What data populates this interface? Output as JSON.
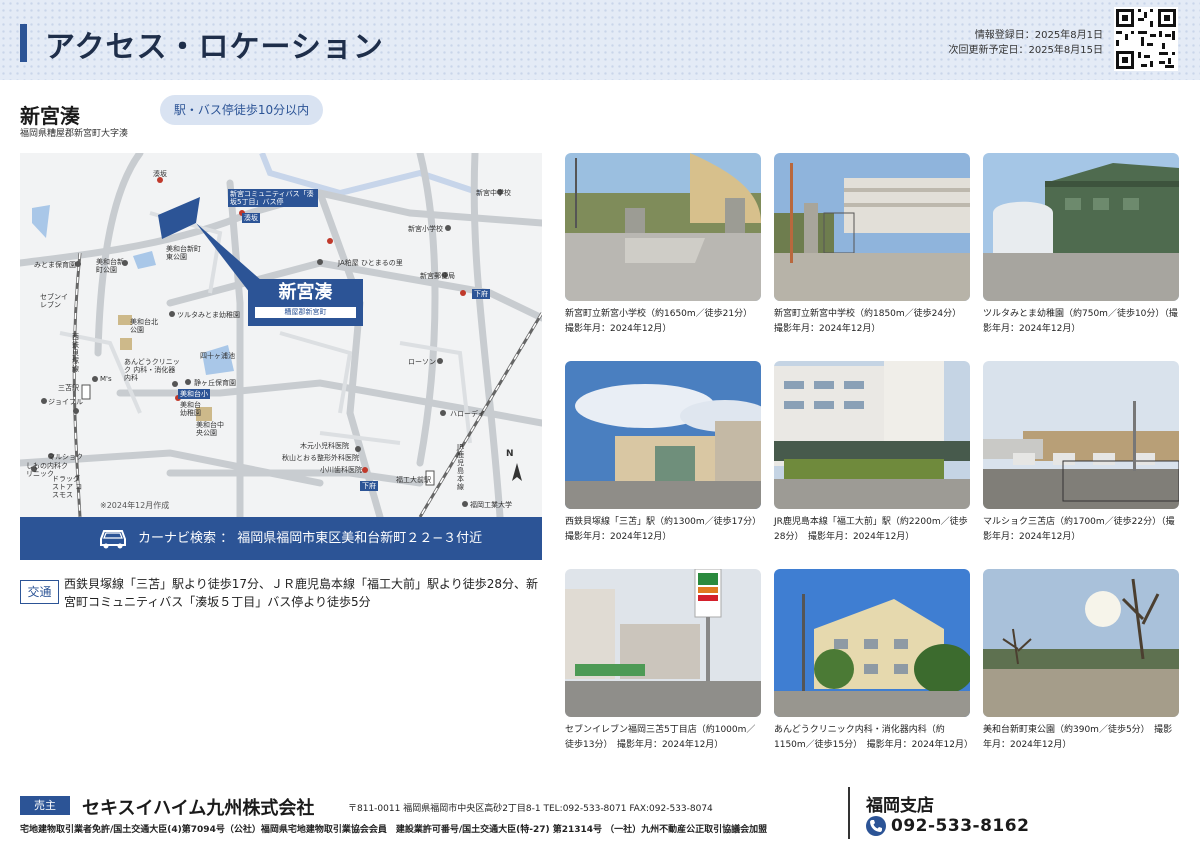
{
  "header": {
    "title": "アクセス・ロケーション",
    "registered": "情報登録日：2025年8月1日",
    "next_update": "次回更新予定日：2025年8月15日"
  },
  "property": {
    "name": "新宮湊",
    "address": "福岡県糟屋郡新宮町大字湊",
    "walk_badge": "駅・バス停徒歩10分以内"
  },
  "map": {
    "callout_name": "新宮湊",
    "callout_sub": "糟屋郡新宮町",
    "made": "※2024年12月作成",
    "north": "N",
    "labels": {
      "l_minato": "湊坂",
      "l_bus": "新宮コミュニティバス「湊坂5丁目」バス停",
      "l_bus2": "湊坂",
      "l_mitomahoiku": "みとま保育園",
      "l_miwadai_park": "美和台新町公園",
      "l_miwadai_east": "美和台新町東公園",
      "l_seven": "セブンイレブン",
      "l_miwadai_kita": "美和台北公園",
      "l_tsuruta": "ツルタみとま幼稚園",
      "l_ja": "JA粕屋 ひとまるの里",
      "l_shingu_j": "新宮中学校",
      "l_shingu_e": "新宮小学校",
      "l_shingu_post": "新宮郵便局",
      "l_shimo": "下府",
      "l_nishitetsu": "西鉄貝塚線",
      "l_mitoma": "三苫駅",
      "l_ms": "M's",
      "l_joyful": "ジョイフル",
      "l_ando": "あんどうクリニック 内科・消化器内科",
      "l_shizuka": "静ヶ丘保育園",
      "l_miwadai_sho": "美和台小",
      "l_miwadai_yo": "美和台幼稚園",
      "l_miwadai_chuo": "美和台中央公園",
      "l_yotsuike": "四十ヶ浦池",
      "l_lawson": "ローソン",
      "l_hello": "ハローデイ",
      "l_marushoku": "マルショク",
      "l_shimo_clinic": "しもの内科クリニック",
      "l_drug": "ドラッグストア コスモス",
      "l_kimoto": "木元小児科医院",
      "l_akiyama": "秋山とおる整形外科医院",
      "l_ogawa": "小川歯科医院",
      "l_fukukodai": "福工大前駅",
      "l_fit": "福岡工業大学",
      "l_jr": "JR鹿児島本線",
      "l_shimofu": "下府"
    }
  },
  "carnav": {
    "label": "カーナビ検索 ： 福岡県福岡市東区美和台新町２２−３付近"
  },
  "transport": {
    "badge": "交通",
    "text": "西鉄貝塚線「三苫」駅より徒歩17分、ＪＲ鹿児島本線「福工大前」駅より徒歩28分、新宮町コミュニティバス「湊坂５丁目」バス停より徒歩5分"
  },
  "photos": [
    {
      "caption": "新宮町立新宮小学校（約1650m／徒歩21分）　撮影年月：2024年12月）"
    },
    {
      "caption": "新宮町立新宮中学校（約1850m／徒歩24分）　撮影年月：2024年12月）"
    },
    {
      "caption": "ツルタみとま幼稚園（約750m／徒歩10分）（撮影年月：2024年12月）"
    },
    {
      "caption": "西鉄貝塚線「三苫」駅（約1300m／徒歩17分）　撮影年月：2024年12月）"
    },
    {
      "caption": "JR鹿児島本線「福工大前」駅（約2200m／徒歩28分）　撮影年月：2024年12月）"
    },
    {
      "caption": "マルショク三苫店（約1700m／徒歩22分）（撮影年月：2024年12月）"
    },
    {
      "caption": "セブンイレブン福岡三苫5丁目店（約1000m／徒歩13分）　撮影年月：2024年12月）"
    },
    {
      "caption": "あんどうクリニック内科・消化器内科（約1150m／徒歩15分）　撮影年月：2024年12月）"
    },
    {
      "caption": "美和台新町東公園（約390m／徒歩5分）　撮影年月：2024年12月）"
    }
  ],
  "footer": {
    "seller_badge": "売主",
    "company": "セキスイハイム九州株式会社",
    "address": "〒811-0011 福岡県福岡市中央区高砂2丁目8-1 TEL:092-533-8071 FAX:092-533-8074",
    "license": "宅地建物取引業者免許/国土交通大臣(4)第7094号（公社）福岡県宅地建物取引業協会会員　建設業許可番号/国土交通大臣(特-27) 第21314号 （一社）九州不動産公正取引協議会加盟",
    "branch": "福岡支店",
    "phone": "092-533-8162"
  },
  "colors": {
    "brand": "#2c5496",
    "header_bg": "#e4ebf6",
    "badge_bg": "#d9e3f2"
  }
}
